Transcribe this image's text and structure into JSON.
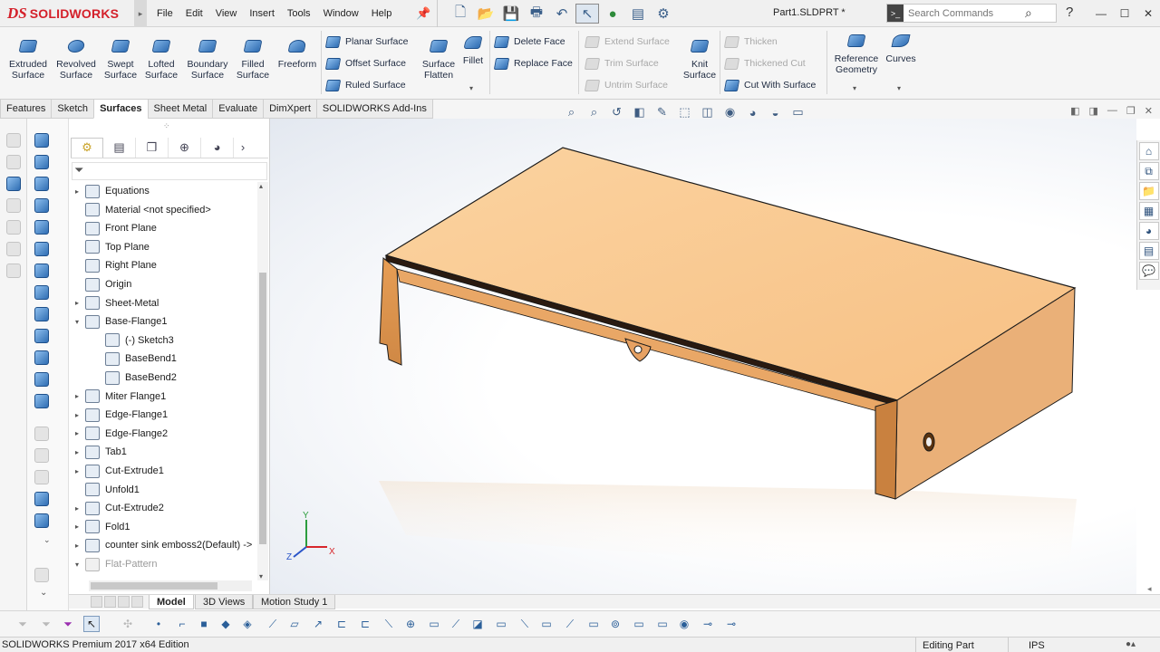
{
  "app": {
    "logo_ds": "DS",
    "logo_text": "SOLIDWORKS",
    "document_title": "Part1.SLDPRT *",
    "search_placeholder": "Search Commands"
  },
  "menu": [
    "File",
    "Edit",
    "View",
    "Insert",
    "Tools",
    "Window",
    "Help"
  ],
  "command_manager": {
    "large_buttons": [
      {
        "label_lines": [
          "Extruded",
          "Surface"
        ]
      },
      {
        "label_lines": [
          "Revolved",
          "Surface"
        ]
      },
      {
        "label_lines": [
          "Swept",
          "Surface"
        ]
      },
      {
        "label_lines": [
          "Lofted",
          "Surface"
        ]
      },
      {
        "label_lines": [
          "Boundary",
          "Surface"
        ]
      },
      {
        "label_lines": [
          "Filled",
          "Surface"
        ]
      },
      {
        "label_lines": [
          "Freeform",
          ""
        ]
      }
    ],
    "group1": [
      "Planar Surface",
      "Offset Surface",
      "Ruled Surface"
    ],
    "surface_flatten": [
      "Surface",
      "Flatten"
    ],
    "fillet": "Fillet",
    "group2": [
      "Delete Face",
      "Replace Face"
    ],
    "group3_disabled": [
      "Extend Surface",
      "Trim Surface",
      "Untrim Surface"
    ],
    "knit_surface": [
      "Knit",
      "Surface"
    ],
    "group4": [
      {
        "label": "Thicken",
        "enabled": false
      },
      {
        "label": "Thickened Cut",
        "enabled": false
      },
      {
        "label": "Cut With Surface",
        "enabled": true
      }
    ],
    "reference_geometry": [
      "Reference",
      "Geometry"
    ],
    "curves": "Curves"
  },
  "tabs": [
    {
      "label": "Features",
      "active": false
    },
    {
      "label": "Sketch",
      "active": false
    },
    {
      "label": "Surfaces",
      "active": true
    },
    {
      "label": "Sheet Metal",
      "active": false
    },
    {
      "label": "Evaluate",
      "active": false
    },
    {
      "label": "DimXpert",
      "active": false
    },
    {
      "label": "SOLIDWORKS Add-Ins",
      "active": false
    }
  ],
  "feature_tree": [
    {
      "label": "Equations",
      "expander": "▸",
      "indent": 0
    },
    {
      "label": "Material <not specified>",
      "expander": "",
      "indent": 0
    },
    {
      "label": "Front Plane",
      "expander": "",
      "indent": 0
    },
    {
      "label": "Top Plane",
      "expander": "",
      "indent": 0
    },
    {
      "label": "Right Plane",
      "expander": "",
      "indent": 0
    },
    {
      "label": "Origin",
      "expander": "",
      "indent": 0
    },
    {
      "label": "Sheet-Metal",
      "expander": "▸",
      "indent": 0
    },
    {
      "label": "Base-Flange1",
      "expander": "▾",
      "indent": 0
    },
    {
      "label": "(-) Sketch3",
      "expander": "",
      "indent": 1
    },
    {
      "label": "BaseBend1",
      "expander": "",
      "indent": 1
    },
    {
      "label": "BaseBend2",
      "expander": "",
      "indent": 1
    },
    {
      "label": "Miter Flange1",
      "expander": "▸",
      "indent": 0
    },
    {
      "label": "Edge-Flange1",
      "expander": "▸",
      "indent": 0
    },
    {
      "label": "Edge-Flange2",
      "expander": "▸",
      "indent": 0
    },
    {
      "label": "Tab1",
      "expander": "▸",
      "indent": 0
    },
    {
      "label": "Cut-Extrude1",
      "expander": "▸",
      "indent": 0
    },
    {
      "label": "Unfold1",
      "expander": "",
      "indent": 0
    },
    {
      "label": "Cut-Extrude2",
      "expander": "▸",
      "indent": 0
    },
    {
      "label": "Fold1",
      "expander": "▸",
      "indent": 0
    },
    {
      "label": "counter sink emboss2(Default) ->",
      "expander": "▸",
      "indent": 0
    },
    {
      "label": "Flat-Pattern",
      "expander": "▾",
      "indent": 0,
      "dim": true
    }
  ],
  "model_tabs": [
    {
      "label": "Model",
      "active": true
    },
    {
      "label": "3D Views",
      "active": false
    },
    {
      "label": "Motion Study 1",
      "active": false
    }
  ],
  "triad": {
    "x": "X",
    "y": "Y",
    "z": "Z"
  },
  "status": {
    "edition": "SOLIDWORKS Premium 2017 x64 Edition",
    "mode": "Editing Part",
    "units": "IPS"
  },
  "colors": {
    "part_top": "#f9c88f",
    "part_side": "#e29a56",
    "part_edge": "#1a1a1a",
    "accent_blue": "#2f6db3",
    "brand_red": "#d4202a"
  }
}
